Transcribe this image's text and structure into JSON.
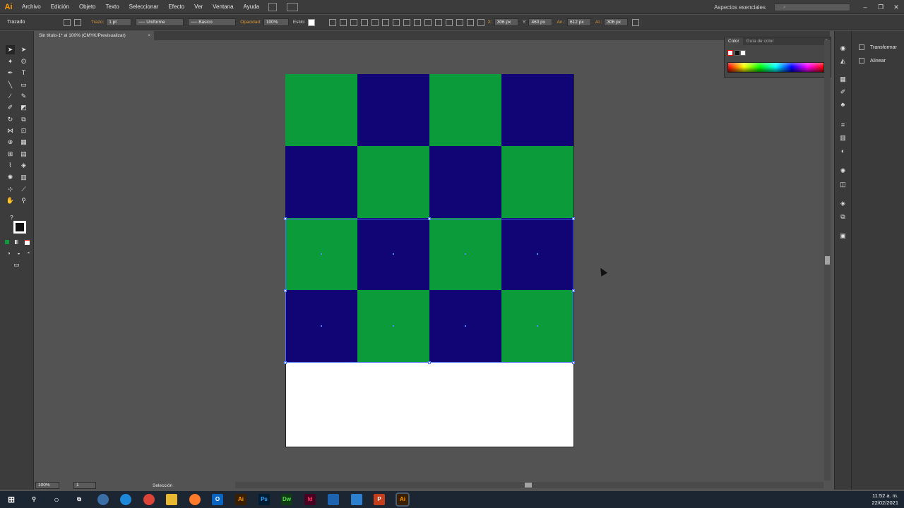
{
  "app": {
    "logo": "Ai"
  },
  "menu": [
    "Archivo",
    "Edición",
    "Objeto",
    "Texto",
    "Seleccionar",
    "Efecto",
    "Ver",
    "Ventana",
    "Ayuda"
  ],
  "workspace_label": "Aspectos esenciales",
  "control": {
    "selection_label": "Trazado",
    "stroke_label": "Trazo:",
    "stroke_value": "1 pt",
    "stroke_profile": "Uniforme",
    "brush": "Básico",
    "opacity_label": "Opacidad:",
    "opacity_value": "100%",
    "style_label": "Estilo:",
    "x_label": "X:",
    "x_value": "306 px",
    "y_label": "Y:",
    "y_value": "460 px",
    "w_label": "An.:",
    "w_value": "612 px",
    "h_label": "Al.:",
    "h_value": "306 px"
  },
  "document_tab": {
    "title": "Sin título-1* al 100% (CMYK/Previsualizar)",
    "close": "×"
  },
  "color_panel": {
    "tabs": [
      "Color",
      "Guía de color"
    ],
    "menu": "≡"
  },
  "right_panel": {
    "items": [
      "Transformar",
      "Alinear"
    ]
  },
  "status": {
    "zoom": "100%",
    "page": "1",
    "tool": "Selección"
  },
  "grid": {
    "rows": [
      [
        "green",
        "navy",
        "green",
        "navy"
      ],
      [
        "navy",
        "green",
        "navy",
        "green"
      ],
      [
        "green",
        "navy",
        "green",
        "navy"
      ],
      [
        "navy",
        "green",
        "navy",
        "green"
      ]
    ],
    "colors": {
      "green": "#0c9b3a",
      "navy": "#110575"
    }
  },
  "taskbar": {
    "apps": [
      "start-icon",
      "search-icon",
      "cortana-icon",
      "task-view-icon",
      "app-icon",
      "edge-icon",
      "chrome-icon",
      "file-explorer-icon",
      "firefox-icon",
      "outlook-icon",
      "illustrator-icon",
      "photoshop-icon",
      "dreamweaver-icon",
      "indesign-icon",
      "vscode-icon",
      "photos-icon",
      "powerpoint-icon",
      "illustrator-active-icon"
    ],
    "labels": {
      "outlook": "O",
      "illustrator": "Ai",
      "photoshop": "Ps",
      "dreamweaver": "Dw",
      "indesign": "Id",
      "powerpoint": "P",
      "illustrator_active": "Ai"
    },
    "time": "11:52 a. m.",
    "date": "22/02/2021"
  }
}
